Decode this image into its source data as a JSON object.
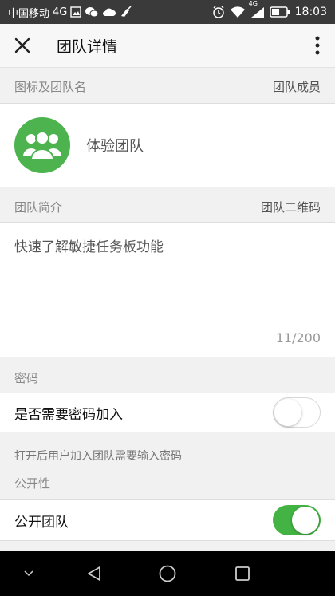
{
  "status_bar": {
    "carrier": "中国移动",
    "network": "4G",
    "network_small": "4G",
    "time": "18:03"
  },
  "app_bar": {
    "title": "团队详情"
  },
  "section_icon": {
    "left": "图标及团队名",
    "right": "团队成员"
  },
  "team": {
    "name": "体验团队"
  },
  "section_intro": {
    "left": "团队简介",
    "right": "团队二维码"
  },
  "intro": {
    "text": "快速了解敏捷任务板功能",
    "count": "11/200"
  },
  "section_password": {
    "label": "密码"
  },
  "password_row": {
    "label": "是否需要密码加入",
    "enabled": false
  },
  "password_hint": "打开后用户加入团队需要输入密码",
  "section_public": {
    "label": "公开性"
  },
  "public_row": {
    "label": "公开团队",
    "enabled": true
  },
  "colors": {
    "accent_green": "#43b343",
    "avatar_green": "#4cb34f"
  }
}
